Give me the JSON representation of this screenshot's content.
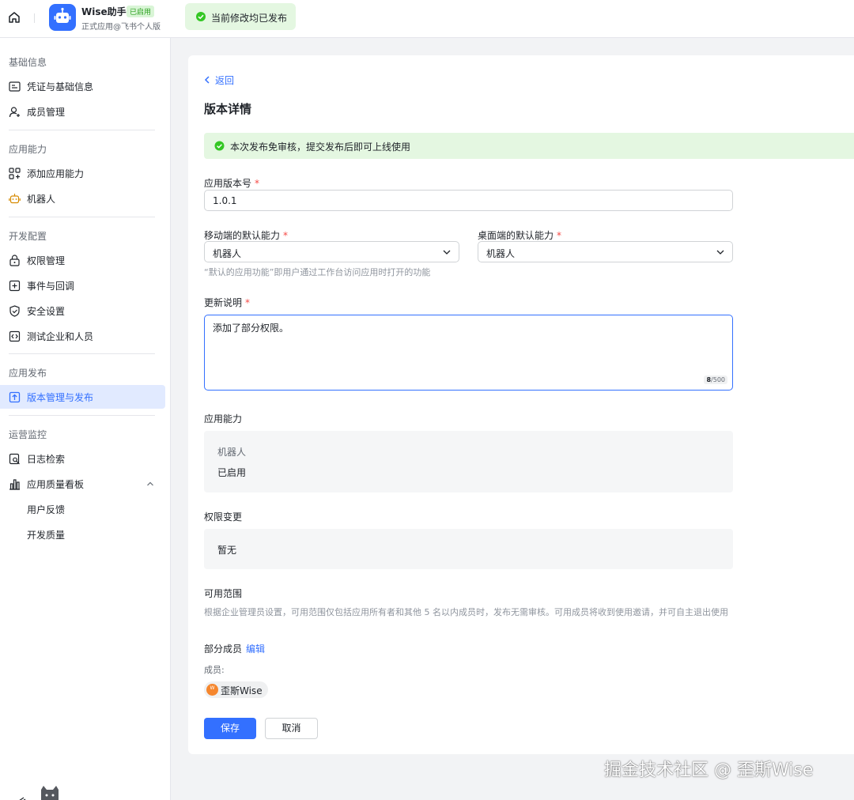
{
  "header": {
    "app_name": "Wise助手",
    "app_status": "已启用",
    "app_subtitle": "正式应用@飞书个人版",
    "toast": "当前修改均已发布"
  },
  "sidebar": {
    "sections": [
      {
        "title": "基础信息",
        "items": [
          {
            "label": "凭证与基础信息",
            "icon": "credential-icon"
          },
          {
            "label": "成员管理",
            "icon": "member-add-icon"
          }
        ]
      },
      {
        "title": "应用能力",
        "items": [
          {
            "label": "添加应用能力",
            "icon": "grid-add-icon"
          },
          {
            "label": "机器人",
            "icon": "robot-icon"
          }
        ]
      },
      {
        "title": "开发配置",
        "items": [
          {
            "label": "权限管理",
            "icon": "lock-icon"
          },
          {
            "label": "事件与回调",
            "icon": "event-icon"
          },
          {
            "label": "安全设置",
            "icon": "shield-icon"
          },
          {
            "label": "测试企业和人员",
            "icon": "code-icon"
          }
        ]
      },
      {
        "title": "应用发布",
        "items": [
          {
            "label": "版本管理与发布",
            "icon": "upload-icon",
            "active": true
          }
        ]
      },
      {
        "title": "运营监控",
        "items": [
          {
            "label": "日志检索",
            "icon": "log-search-icon"
          },
          {
            "label": "应用质量看板",
            "icon": "bar-chart-icon"
          },
          {
            "label": "用户反馈"
          },
          {
            "label": "开发质量"
          }
        ]
      }
    ]
  },
  "main": {
    "back_label": "返回",
    "title": "版本详情",
    "notice": "本次发布免审核，提交发布后即可上线使用",
    "version_label": "应用版本号",
    "version_value": "1.0.1",
    "mobile_label": "移动端的默认能力",
    "mobile_value": "机器人",
    "desktop_label": "桌面端的默认能力",
    "desktop_value": "机器人",
    "default_hint": "“默认的应用功能”即用户通过工作台访问应用时打开的功能",
    "changelog_label": "更新说明",
    "changelog_value": "添加了部分权限。",
    "changelog_count": "8",
    "changelog_max": "/500",
    "abilities_label": "应用能力",
    "ability_name": "机器人",
    "ability_status": "已启用",
    "perm_label": "权限变更",
    "perm_value": "暂无",
    "scope_label": "可用范围",
    "scope_desc": "根据企业管理员设置，可用范围仅包括应用所有者和其他 5 名以内成员时，发布无需审核。可用成员将收到使用邀请，并可自主退出使用",
    "scope_type": "部分成员",
    "edit_label": "编辑",
    "members_label": "成员:",
    "member_name": "歪斯Wise",
    "member_initial": "W",
    "save_label": "保存",
    "cancel_label": "取消",
    "required_mark": "*"
  },
  "watermark": "掘金技术社区 @ 歪斯Wise"
}
